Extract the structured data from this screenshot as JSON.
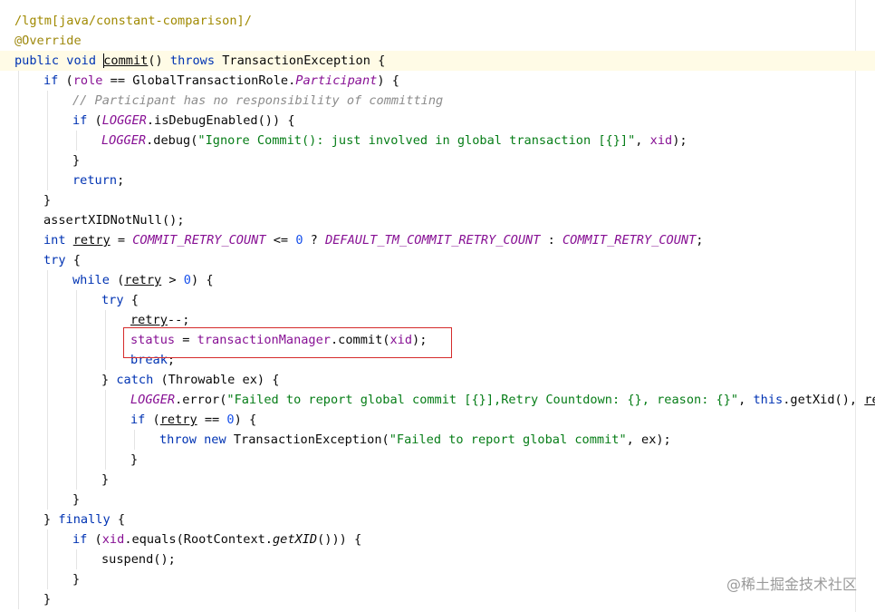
{
  "editor": {
    "lines": [
      {
        "indent": 0,
        "current": false,
        "tokens": [
          {
            "t": "/lgtm[java/constant-comparison]/",
            "c": "tag"
          }
        ]
      },
      {
        "indent": 0,
        "current": false,
        "tokens": [
          {
            "t": "@Override",
            "c": "ann"
          }
        ]
      },
      {
        "indent": 0,
        "current": true,
        "caret_after_token": 3,
        "tokens": [
          {
            "t": "public",
            "c": "kw"
          },
          {
            "t": " ",
            "c": "plain"
          },
          {
            "t": "void",
            "c": "kw"
          },
          {
            "t": " ",
            "c": "plain"
          },
          {
            "t": "commit",
            "c": "plain ul"
          },
          {
            "t": "() ",
            "c": "plain"
          },
          {
            "t": "throws",
            "c": "kw"
          },
          {
            "t": " TransactionException {",
            "c": "plain"
          }
        ]
      },
      {
        "indent": 1,
        "current": false,
        "tokens": [
          {
            "t": "if",
            "c": "kw"
          },
          {
            "t": " (",
            "c": "plain"
          },
          {
            "t": "role",
            "c": "field"
          },
          {
            "t": " == GlobalTransactionRole.",
            "c": "plain"
          },
          {
            "t": "Participant",
            "c": "field-it"
          },
          {
            "t": ") {",
            "c": "plain"
          }
        ]
      },
      {
        "indent": 2,
        "current": false,
        "tokens": [
          {
            "t": "// Participant has no responsibility of committing",
            "c": "cmt"
          }
        ]
      },
      {
        "indent": 2,
        "current": false,
        "tokens": [
          {
            "t": "if",
            "c": "kw"
          },
          {
            "t": " (",
            "c": "plain"
          },
          {
            "t": "LOGGER",
            "c": "field-it"
          },
          {
            "t": ".isDebugEnabled()) {",
            "c": "plain"
          }
        ]
      },
      {
        "indent": 3,
        "current": false,
        "tokens": [
          {
            "t": "LOGGER",
            "c": "field-it"
          },
          {
            "t": ".debug(",
            "c": "plain"
          },
          {
            "t": "\"Ignore Commit(): just involved in global transaction [{}]\"",
            "c": "str"
          },
          {
            "t": ", ",
            "c": "plain"
          },
          {
            "t": "xid",
            "c": "field"
          },
          {
            "t": ");",
            "c": "plain"
          }
        ]
      },
      {
        "indent": 2,
        "current": false,
        "tokens": [
          {
            "t": "}",
            "c": "plain"
          }
        ]
      },
      {
        "indent": 2,
        "current": false,
        "tokens": [
          {
            "t": "return",
            "c": "kw"
          },
          {
            "t": ";",
            "c": "plain"
          }
        ]
      },
      {
        "indent": 1,
        "current": false,
        "tokens": [
          {
            "t": "}",
            "c": "plain"
          }
        ]
      },
      {
        "indent": 1,
        "current": false,
        "tokens": [
          {
            "t": "assertXIDNotNull();",
            "c": "plain"
          }
        ]
      },
      {
        "indent": 1,
        "current": false,
        "tokens": [
          {
            "t": "int",
            "c": "kw"
          },
          {
            "t": " ",
            "c": "plain"
          },
          {
            "t": "retry",
            "c": "plain ul"
          },
          {
            "t": " = ",
            "c": "plain"
          },
          {
            "t": "COMMIT_RETRY_COUNT",
            "c": "field-it"
          },
          {
            "t": " <= ",
            "c": "plain"
          },
          {
            "t": "0",
            "c": "num"
          },
          {
            "t": " ? ",
            "c": "plain"
          },
          {
            "t": "DEFAULT_TM_COMMIT_RETRY_COUNT",
            "c": "field-it"
          },
          {
            "t": " : ",
            "c": "plain"
          },
          {
            "t": "COMMIT_RETRY_COUNT",
            "c": "field-it"
          },
          {
            "t": ";",
            "c": "plain"
          }
        ]
      },
      {
        "indent": 1,
        "current": false,
        "tokens": [
          {
            "t": "try",
            "c": "kw"
          },
          {
            "t": " {",
            "c": "plain"
          }
        ]
      },
      {
        "indent": 2,
        "current": false,
        "tokens": [
          {
            "t": "while",
            "c": "kw"
          },
          {
            "t": " (",
            "c": "plain"
          },
          {
            "t": "retry",
            "c": "plain ul"
          },
          {
            "t": " > ",
            "c": "plain"
          },
          {
            "t": "0",
            "c": "num"
          },
          {
            "t": ") {",
            "c": "plain"
          }
        ]
      },
      {
        "indent": 3,
        "current": false,
        "tokens": [
          {
            "t": "try",
            "c": "kw"
          },
          {
            "t": " {",
            "c": "plain"
          }
        ]
      },
      {
        "indent": 4,
        "current": false,
        "tokens": [
          {
            "t": "retry",
            "c": "plain ul"
          },
          {
            "t": "--;",
            "c": "plain"
          }
        ]
      },
      {
        "indent": 4,
        "current": false,
        "tokens": [
          {
            "t": "status",
            "c": "field"
          },
          {
            "t": " = ",
            "c": "plain"
          },
          {
            "t": "transactionManager",
            "c": "field"
          },
          {
            "t": ".commit(",
            "c": "plain"
          },
          {
            "t": "xid",
            "c": "field"
          },
          {
            "t": ");",
            "c": "plain"
          }
        ]
      },
      {
        "indent": 4,
        "current": false,
        "tokens": [
          {
            "t": "break",
            "c": "kw"
          },
          {
            "t": ";",
            "c": "plain"
          }
        ]
      },
      {
        "indent": 3,
        "current": false,
        "tokens": [
          {
            "t": "} ",
            "c": "plain"
          },
          {
            "t": "catch",
            "c": "kw"
          },
          {
            "t": " (Throwable ex) {",
            "c": "plain"
          }
        ]
      },
      {
        "indent": 4,
        "current": false,
        "tokens": [
          {
            "t": "LOGGER",
            "c": "field-it"
          },
          {
            "t": ".error(",
            "c": "plain"
          },
          {
            "t": "\"Failed to report global commit [{}],Retry Countdown: {}, reason: {}\"",
            "c": "str"
          },
          {
            "t": ", ",
            "c": "plain"
          },
          {
            "t": "this",
            "c": "kw"
          },
          {
            "t": ".getXid(), ",
            "c": "plain"
          },
          {
            "t": "retr",
            "c": "plain ul"
          }
        ]
      },
      {
        "indent": 4,
        "current": false,
        "tokens": [
          {
            "t": "if",
            "c": "kw"
          },
          {
            "t": " (",
            "c": "plain"
          },
          {
            "t": "retry",
            "c": "plain ul"
          },
          {
            "t": " == ",
            "c": "plain"
          },
          {
            "t": "0",
            "c": "num"
          },
          {
            "t": ") {",
            "c": "plain"
          }
        ]
      },
      {
        "indent": 5,
        "current": false,
        "tokens": [
          {
            "t": "throw",
            "c": "kw"
          },
          {
            "t": " ",
            "c": "plain"
          },
          {
            "t": "new",
            "c": "kw"
          },
          {
            "t": " TransactionException(",
            "c": "plain"
          },
          {
            "t": "\"Failed to report global commit\"",
            "c": "str"
          },
          {
            "t": ", ex);",
            "c": "plain"
          }
        ]
      },
      {
        "indent": 4,
        "current": false,
        "tokens": [
          {
            "t": "}",
            "c": "plain"
          }
        ]
      },
      {
        "indent": 3,
        "current": false,
        "tokens": [
          {
            "t": "}",
            "c": "plain"
          }
        ]
      },
      {
        "indent": 2,
        "current": false,
        "tokens": [
          {
            "t": "}",
            "c": "plain"
          }
        ]
      },
      {
        "indent": 1,
        "current": false,
        "tokens": [
          {
            "t": "} ",
            "c": "plain"
          },
          {
            "t": "finally",
            "c": "kw"
          },
          {
            "t": " {",
            "c": "plain"
          }
        ]
      },
      {
        "indent": 2,
        "current": false,
        "tokens": [
          {
            "t": "if",
            "c": "kw"
          },
          {
            "t": " (",
            "c": "plain"
          },
          {
            "t": "xid",
            "c": "field"
          },
          {
            "t": ".equals(RootContext.",
            "c": "plain"
          },
          {
            "t": "getXID",
            "c": "plain it"
          },
          {
            "t": "())) {",
            "c": "plain"
          }
        ]
      },
      {
        "indent": 3,
        "current": false,
        "tokens": [
          {
            "t": "suspend();",
            "c": "plain"
          }
        ]
      },
      {
        "indent": 2,
        "current": false,
        "tokens": [
          {
            "t": "}",
            "c": "plain"
          }
        ]
      },
      {
        "indent": 1,
        "current": false,
        "tokens": [
          {
            "t": "}",
            "c": "plain"
          }
        ]
      }
    ]
  },
  "highlight": {
    "color": "#d52b2b",
    "line_index": 16
  },
  "watermark": "@稀土掘金技术社区"
}
